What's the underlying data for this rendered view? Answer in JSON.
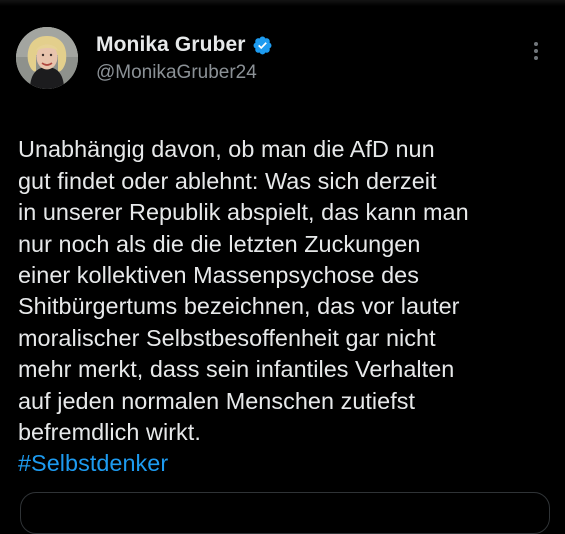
{
  "author": {
    "display_name": "Monika Gruber",
    "handle": "@MonikaGruber24",
    "verified": true,
    "avatar_icon": "profile-photo"
  },
  "tweet": {
    "text": "Unabhängig davon, ob man die AfD nun\ngut findet oder ablehnt: Was  sich derzeit\nin unserer Republik abspielt, das kann man\nnur noch als die die letzten Zuckungen\neiner kollektiven Massenpsychose des\nShitbürgertums bezeichnen, das vor lauter\nmoralischer Selbstbesoffenheit gar nicht\nmehr merkt, dass sein infantiles Verhalten\nauf jeden normalen Menschen zutiefst\nbefremdlich wirkt.",
    "hashtag": "#Selbstdenker"
  },
  "icons": {
    "verified": "verified-badge-icon",
    "more": "more-options-icon"
  },
  "colors": {
    "background": "#000000",
    "text": "#e7e9ea",
    "secondary_text": "#8b9196",
    "link": "#1d9bf0",
    "verified": "#1d9bf0",
    "border": "#2f3336"
  }
}
